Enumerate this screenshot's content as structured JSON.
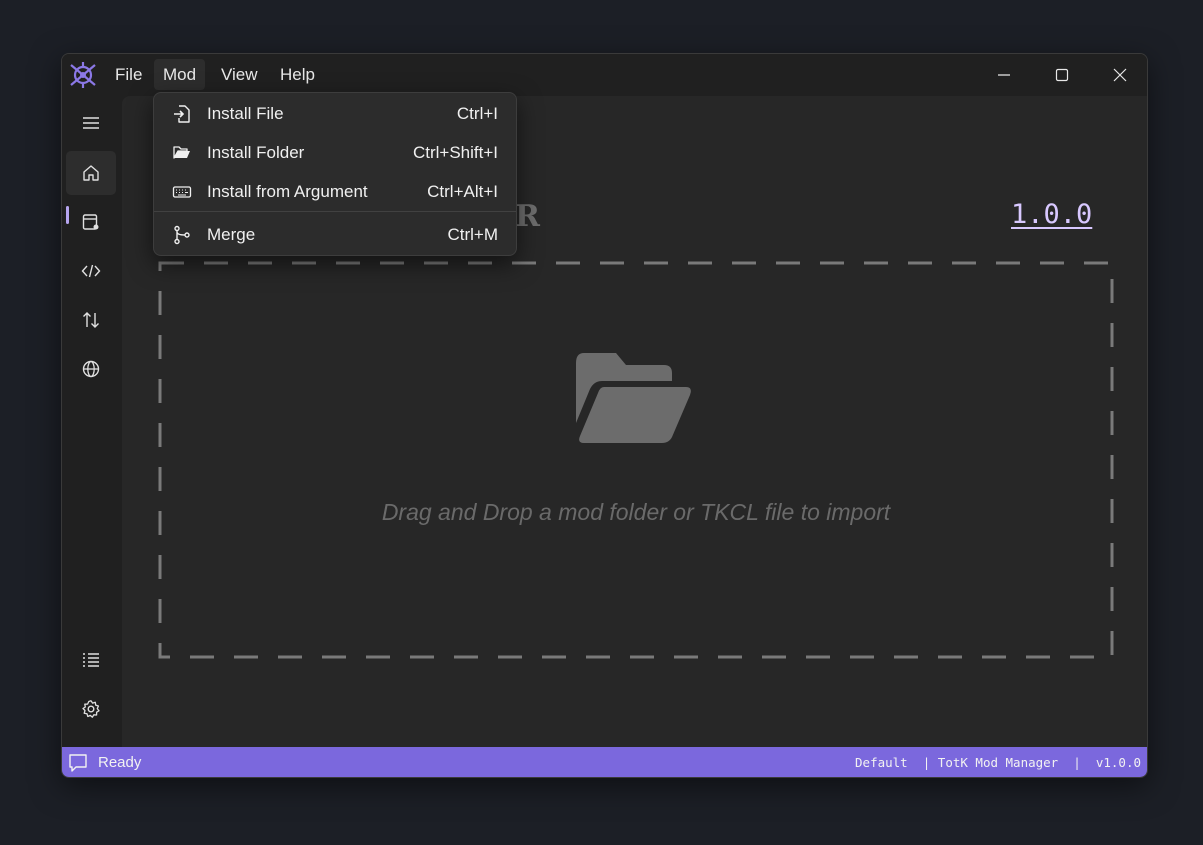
{
  "menubar": {
    "items": [
      {
        "label": "File"
      },
      {
        "label": "Mod"
      },
      {
        "label": "View"
      },
      {
        "label": "Help"
      }
    ]
  },
  "mod_menu": {
    "items": [
      {
        "label": "Install File",
        "shortcut": "Ctrl+I",
        "icon": "file-import-icon"
      },
      {
        "label": "Install Folder",
        "shortcut": "Ctrl+Shift+I",
        "icon": "folder-open-icon"
      },
      {
        "label": "Install from Argument",
        "shortcut": "Ctrl+Alt+I",
        "icon": "keyboard-icon"
      },
      {
        "label": "Merge",
        "shortcut": "Ctrl+M",
        "icon": "merge-icon"
      }
    ]
  },
  "sidebar": {
    "items": [
      {
        "icon": "hamburger-menu-icon"
      },
      {
        "icon": "home-icon",
        "selected": true
      },
      {
        "icon": "mod-list-icon"
      },
      {
        "icon": "code-icon"
      },
      {
        "icon": "sort-arrows-icon"
      },
      {
        "icon": "globe-icon"
      },
      {
        "icon": "list-icon"
      },
      {
        "icon": "settings-gear-icon"
      }
    ]
  },
  "main": {
    "header_fragment": "R",
    "version": "1.0.0",
    "drop_text": "Drag and Drop a mod folder or TKCL file to import"
  },
  "status": {
    "text": "Ready",
    "right": "Default  | TotK Mod Manager  |  v1.0.0"
  },
  "colors": {
    "accent": "#7b68dd",
    "version_text": "#d8c8ff"
  }
}
